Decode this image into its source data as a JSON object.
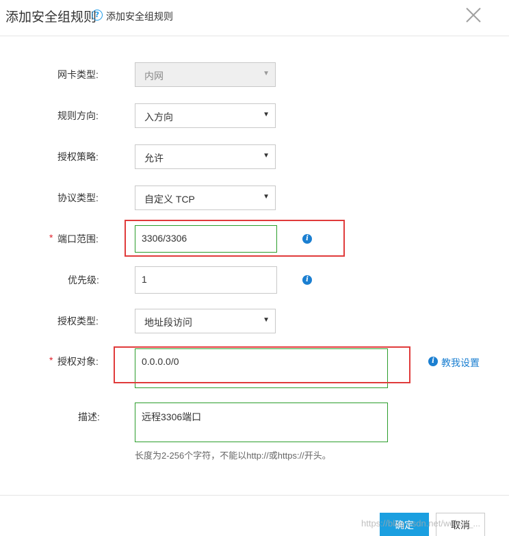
{
  "header": {
    "title": "添加安全组规则",
    "help_icon": "question-circle-icon",
    "help_text": "添加安全组规则",
    "close_icon": "close-icon"
  },
  "form": {
    "nic_type": {
      "label": "网卡类型:",
      "value": "内网",
      "disabled": true
    },
    "rule_direction": {
      "label": "规则方向:",
      "value": "入方向"
    },
    "auth_policy": {
      "label": "授权策略:",
      "value": "允许"
    },
    "protocol_type": {
      "label": "协议类型:",
      "value": "自定义 TCP"
    },
    "port_range": {
      "required_mark": "*",
      "label": "端口范围:",
      "value": "3306/3306",
      "info_icon": "info-icon"
    },
    "priority": {
      "label": "优先级:",
      "value": "1",
      "info_icon": "info-icon"
    },
    "auth_type": {
      "label": "授权类型:",
      "value": "地址段访问"
    },
    "auth_object": {
      "required_mark": "*",
      "label": "授权对象:",
      "value": "0.0.0.0/0",
      "help_link": "教我设置"
    },
    "description": {
      "label": "描述:",
      "value": "远程3306端口",
      "hint": "长度为2-256个字符，不能以http://或https://开头。"
    }
  },
  "footer": {
    "ok_label": "确定",
    "cancel_label": "取消"
  },
  "watermark": "https://blog.csdn.net/weixin_...",
  "colors": {
    "accent": "#1b9fe0",
    "valid_border": "#2a9d2a",
    "required": "#e0202a",
    "annotation_red": "#e03a3a"
  }
}
